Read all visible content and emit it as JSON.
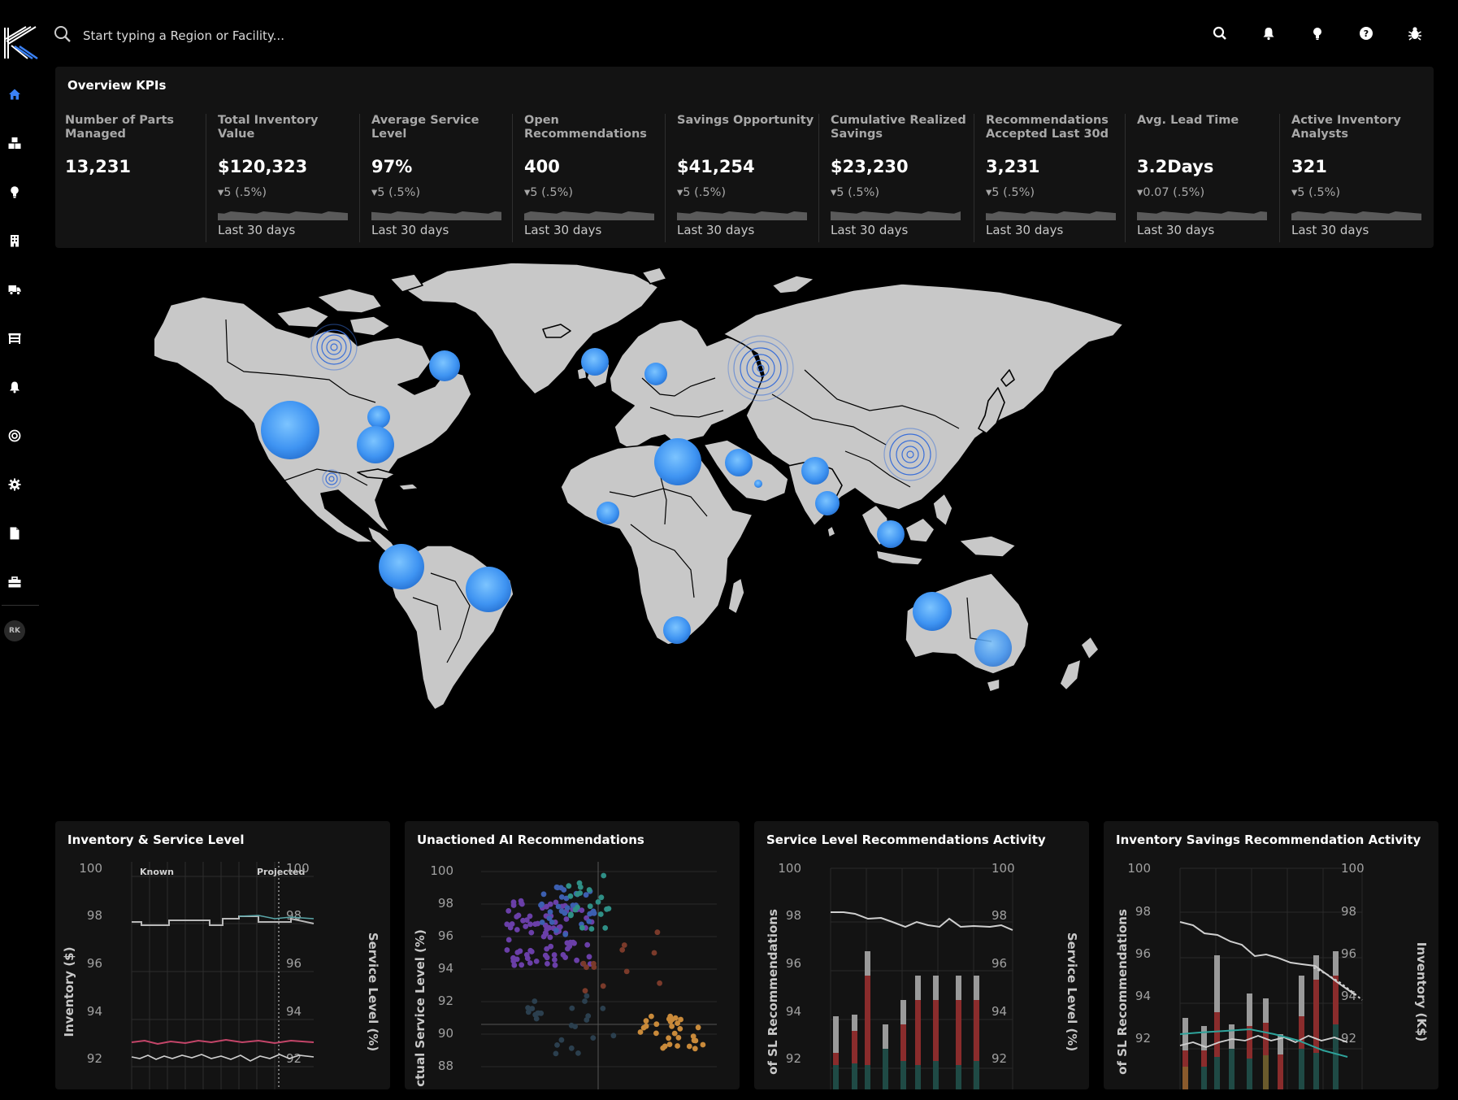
{
  "search": {
    "placeholder": "Start typing a Region or Facility..."
  },
  "topbar": {
    "icons": [
      "search-icon",
      "bell-icon",
      "lightbulb-icon",
      "help-icon",
      "bug-icon"
    ]
  },
  "sidebar": {
    "items": [
      "home-icon",
      "boxes-icon",
      "lightbulb-icon",
      "building-icon",
      "truck-icon",
      "warehouse-icon",
      "bell-icon",
      "target-icon",
      "gear-icon",
      "document-icon",
      "toolbox-icon"
    ],
    "avatar": "RK"
  },
  "kpis": {
    "title": "Overview KPIs",
    "items": [
      {
        "label": "Number of Parts Managed",
        "value": "13,231",
        "delta": "",
        "period": ""
      },
      {
        "label": "Total Inventory Value",
        "value": "$120,323",
        "delta": "5 (.5%)",
        "period": "Last 30 days"
      },
      {
        "label": "Average Service Level",
        "value": "97%",
        "delta": "5 (.5%)",
        "period": "Last 30 days"
      },
      {
        "label": "Open Recommendations",
        "value": "400",
        "delta": "5 (.5%)",
        "period": "Last 30 days"
      },
      {
        "label": "Savings Opportunity",
        "value": "$41,254",
        "delta": "5 (.5%)",
        "period": "Last 30 days"
      },
      {
        "label": "Cumulative Realized Savings",
        "value": "$23,230",
        "delta": "5 (.5%)",
        "period": "Last 30 days"
      },
      {
        "label": "Recommendations Accepted Last 30d",
        "value": "3,231",
        "delta": "5 (.5%)",
        "period": "Last 30 days"
      },
      {
        "label": "Avg. Lead Time",
        "value": "3.2Days",
        "delta": "0.07 (.5%)",
        "period": "Last 30 days"
      },
      {
        "label": "Active Inventory Analysts",
        "value": "321",
        "delta": "5 (.5%)",
        "period": "Last 30 days"
      }
    ]
  },
  "map": {
    "bubble_color": "#4a9ff5",
    "land_color": "#c8c8c8"
  },
  "charts": {
    "inventory_service": {
      "title": "Inventory & Service Level",
      "left_ticks": [
        "100",
        "98",
        "96",
        "94",
        "92"
      ],
      "right_ticks": [
        "100",
        "98",
        "96",
        "94",
        "92"
      ],
      "left_label": "Inventory ($)",
      "right_label": "Service Level (%)",
      "known": "Known",
      "projected": "Projected"
    },
    "unactioned": {
      "title": "Unactioned AI Recommendations",
      "ticks": [
        "100",
        "98",
        "96",
        "94",
        "92",
        "90",
        "88"
      ],
      "y_label": "ctual Service Level (%)"
    },
    "sl_activity": {
      "title": "Service Level Recommendations Activity",
      "left_ticks": [
        "100",
        "98",
        "96",
        "94",
        "92"
      ],
      "right_ticks": [
        "100",
        "98",
        "96",
        "94",
        "92"
      ],
      "left_label": "of SL Recommendations",
      "right_label": "Service Level (%)"
    },
    "savings_activity": {
      "title": "Inventory Savings Recommendation Activity",
      "left_ticks": [
        "100",
        "98",
        "96",
        "94",
        "92"
      ],
      "right_ticks": [
        "100",
        "98",
        "96",
        "94",
        "92"
      ],
      "left_label": "of SL Recommendations",
      "right_label": "Inventory (K$)"
    }
  }
}
